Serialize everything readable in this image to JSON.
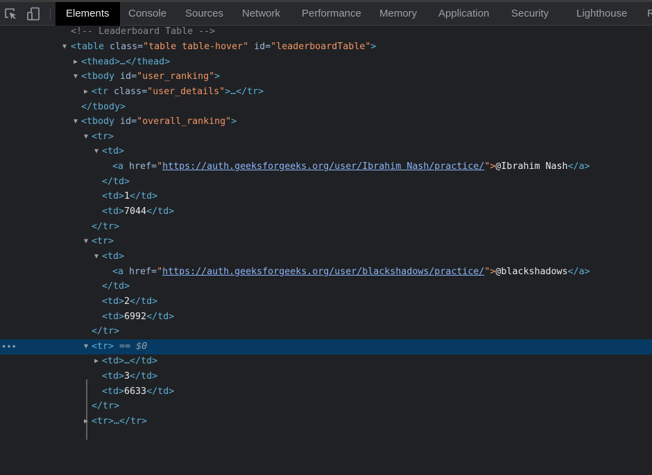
{
  "toolbar": {
    "icons": [
      "inspect-element-icon",
      "device-toolbar-icon"
    ],
    "tabs": [
      {
        "label": "Elements",
        "active": true
      },
      {
        "label": "Console"
      },
      {
        "label": "Sources"
      },
      {
        "label": "Network"
      },
      {
        "label": "Performance"
      },
      {
        "label": "Memory"
      },
      {
        "label": "Application"
      },
      {
        "label": "Security"
      },
      {
        "label": "Lighthouse"
      },
      {
        "label": "R"
      }
    ]
  },
  "dom": {
    "comment": "<!-- Leaderboard Table -->",
    "table_open": {
      "tag": "<table",
      "class_attr": " class=",
      "class_val": "\"table table-hover\"",
      "id_attr": " id=",
      "id_val": "\"leaderboardTable\"",
      "end": ">"
    },
    "thead": "<thead>…</thead>",
    "tbody1_open": {
      "tag": "<tbody",
      "id_attr": " id=",
      "id_val": "\"user_ranking\"",
      "end": ">"
    },
    "tr_user": {
      "tag": "<tr",
      "class_attr": " class=",
      "class_val": "\"user_details\"",
      "end": ">…</tr>"
    },
    "tbody1_close": "</tbody>",
    "tbody2_open": {
      "tag": "<tbody",
      "id_attr": " id=",
      "id_val": "\"overall_ranking\"",
      "end": ">"
    },
    "tr_open": "<tr>",
    "td_open": "<td>",
    "td_close": "</td>",
    "tr_close": "</tr>",
    "a_open": "<a",
    "href_attr": " href=",
    "quote": "\"",
    "a_end": "\">",
    "a_close": "</a>",
    "rows": [
      {
        "href": "https://auth.geeksforgeeks.org/user/Ibrahim Nash/practice/",
        "name": "@Ibrahim Nash",
        "rank": "1",
        "score": "7044"
      },
      {
        "href": "https://auth.geeksforgeeks.org/user/blackshadows/practice/",
        "name": "@blackshadows",
        "rank": "2",
        "score": "6992"
      },
      {
        "collapsed_td": "<td>…</td>",
        "rank": "3",
        "score": "6633"
      }
    ],
    "selected_marker": " == ",
    "selected_var": "$0",
    "collapsed_tr": "<tr>…</tr>",
    "gutter_dots": "•••"
  }
}
